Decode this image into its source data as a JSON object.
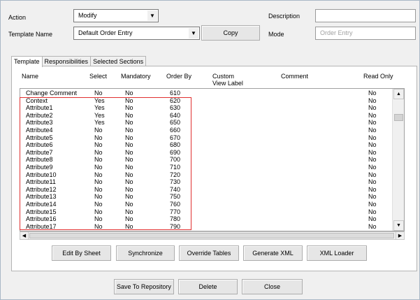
{
  "form": {
    "action_label": "Action",
    "action_value": "Modify",
    "template_name_label": "Template Name",
    "template_name_value": "Default Order Entry",
    "copy_label": "Copy",
    "description_label": "Description",
    "description_value": "",
    "mode_label": "Mode",
    "mode_placeholder": "Order Entry"
  },
  "tabs": [
    {
      "label": "Template"
    },
    {
      "label": "Responsibilities"
    },
    {
      "label": "Selected Sections"
    }
  ],
  "columns": {
    "name": "Name",
    "select": "Select",
    "mandatory": "Mandatory",
    "order_by": "Order By",
    "custom_view_label_1": "Custom",
    "custom_view_label_2": "View Label",
    "comment": "Comment",
    "read_only": "Read Only"
  },
  "rows": [
    {
      "name": "Change Comment",
      "select": "No",
      "mandatory": "No",
      "order": "610",
      "ro": "No"
    },
    {
      "name": "Context",
      "select": "Yes",
      "mandatory": "No",
      "order": "620",
      "ro": "No"
    },
    {
      "name": "Attribute1",
      "select": "Yes",
      "mandatory": "No",
      "order": "630",
      "ro": "No"
    },
    {
      "name": "Attribute2",
      "select": "Yes",
      "mandatory": "No",
      "order": "640",
      "ro": "No"
    },
    {
      "name": "Attribute3",
      "select": "Yes",
      "mandatory": "No",
      "order": "650",
      "ro": "No"
    },
    {
      "name": "Attribute4",
      "select": "No",
      "mandatory": "No",
      "order": "660",
      "ro": "No"
    },
    {
      "name": "Attribute5",
      "select": "No",
      "mandatory": "No",
      "order": "670",
      "ro": "No"
    },
    {
      "name": "Attribute6",
      "select": "No",
      "mandatory": "No",
      "order": "680",
      "ro": "No"
    },
    {
      "name": "Attribute7",
      "select": "No",
      "mandatory": "No",
      "order": "690",
      "ro": "No"
    },
    {
      "name": "Attribute8",
      "select": "No",
      "mandatory": "No",
      "order": "700",
      "ro": "No"
    },
    {
      "name": "Attribute9",
      "select": "No",
      "mandatory": "No",
      "order": "710",
      "ro": "No"
    },
    {
      "name": "Attribute10",
      "select": "No",
      "mandatory": "No",
      "order": "720",
      "ro": "No"
    },
    {
      "name": "Attribute11",
      "select": "No",
      "mandatory": "No",
      "order": "730",
      "ro": "No"
    },
    {
      "name": "Attribute12",
      "select": "No",
      "mandatory": "No",
      "order": "740",
      "ro": "No"
    },
    {
      "name": "Attribute13",
      "select": "No",
      "mandatory": "No",
      "order": "750",
      "ro": "No"
    },
    {
      "name": "Attribute14",
      "select": "No",
      "mandatory": "No",
      "order": "760",
      "ro": "No"
    },
    {
      "name": "Attribute15",
      "select": "No",
      "mandatory": "No",
      "order": "770",
      "ro": "No"
    },
    {
      "name": "Attribute16",
      "select": "No",
      "mandatory": "No",
      "order": "780",
      "ro": "No"
    },
    {
      "name": "Attribute17",
      "select": "No",
      "mandatory": "No",
      "order": "790",
      "ro": "No"
    }
  ],
  "panel_buttons": {
    "edit_by_sheet": "Edit By Sheet",
    "synchronize": "Synchronize",
    "override_tables": "Override Tables",
    "generate_xml": "Generate XML",
    "xml_loader": "XML Loader"
  },
  "footer_buttons": {
    "save_to_repository": "Save To Repository",
    "delete": "Delete",
    "close": "Close"
  },
  "icons": {
    "dropdown": "chevron-down-icon",
    "scroll_up": "arrow-up-icon",
    "scroll_down": "arrow-down-icon",
    "scroll_left": "arrow-left-icon",
    "scroll_right": "arrow-right-icon"
  },
  "colors": {
    "highlight": "#e03030",
    "window_bg": "#f0f0f0"
  }
}
